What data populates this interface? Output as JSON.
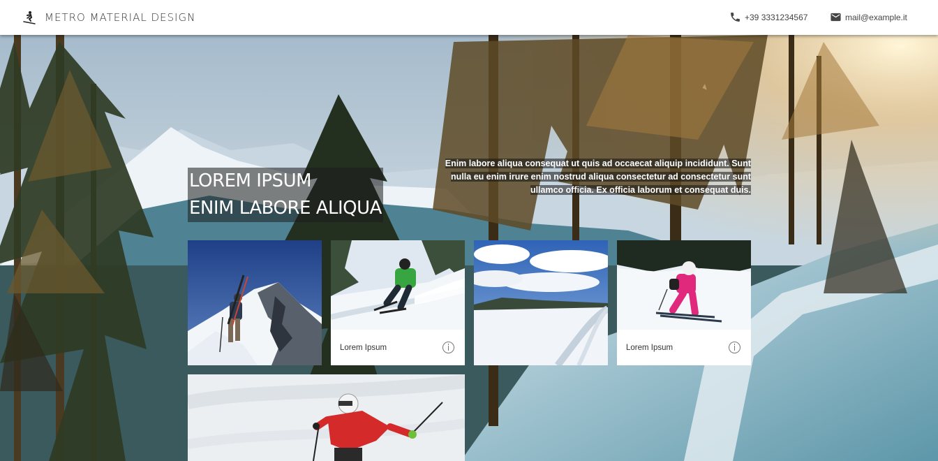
{
  "header": {
    "brand": "METRO MATERIAL DESIGN",
    "brand_icon": "skier-icon",
    "phone": "+39 3331234567",
    "phone_icon": "phone-icon",
    "email": "mail@example.it",
    "email_icon": "mail-icon"
  },
  "hero": {
    "title_line1": "LOREM IPSUM",
    "title_line2": "ENIM LABORE ALIQUA",
    "description": "Enim labore aliqua consequat ut quis ad occaecat aliquip incididunt. Sunt nulla eu enim irure enim nostrud aliqua consectetur ad consectetur sunt ullamco officia. Ex officia laborum et consequat duis."
  },
  "tiles": [
    {
      "image": "skier climbing snowy ridge",
      "caption": ""
    },
    {
      "image": "skier in green jacket carving",
      "caption": "Lorem Ipsum",
      "caption_icon": "info-icon"
    },
    {
      "image": "groomed snowy piste under blue sky",
      "caption": ""
    },
    {
      "image": "child skier in pink suit",
      "caption": "Lorem Ipsum",
      "caption_icon": "info-icon"
    },
    {
      "image": "skier in red jacket on slope",
      "caption": ""
    }
  ],
  "colors": {
    "topbar": "#ffffff",
    "hero_text_bg": "#1e1e1e",
    "sky": "#a9c3d6",
    "snow": "#eef3f7"
  }
}
